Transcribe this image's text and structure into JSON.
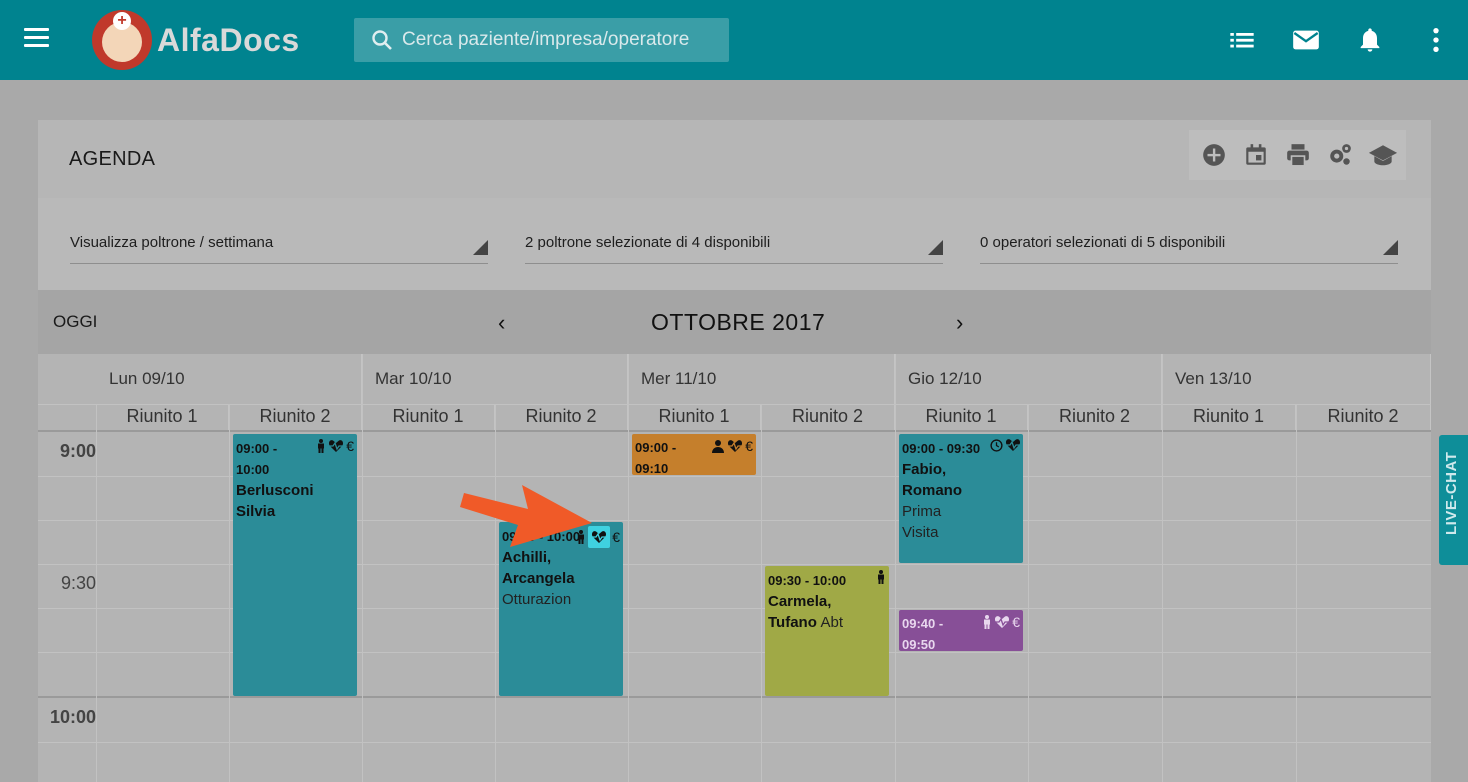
{
  "app": {
    "logo_text": "AlfaDocs"
  },
  "search": {
    "placeholder": "Cerca paziente/impresa/operatore"
  },
  "agenda": {
    "title": "AGENDA",
    "filters": {
      "view": "Visualizza poltrone / settimana",
      "chairs": "2 poltrone selezionate di 4 disponibili",
      "operators": "0 operatori selezionati di 5 disponibili"
    },
    "today_label": "OGGI",
    "month_label": "OTTOBRE 2017",
    "days": [
      "Lun 09/10",
      "Mar 10/10",
      "Mer 11/10",
      "Gio 12/10",
      "Ven 13/10"
    ],
    "chairs": [
      "Riunito 1",
      "Riunito 2"
    ],
    "times": [
      "9:00",
      "9:30",
      "10:00"
    ]
  },
  "appointments": [
    {
      "time": "09:00 - 10:00",
      "name": "Berlusconi Silvia",
      "detail": ""
    },
    {
      "time": "09:00 - 10:00",
      "time_visible": "10:00",
      "name": "Achilli, Arcangela",
      "detail": "Otturazion"
    },
    {
      "time": "09:00 - 09:10",
      "name": "",
      "detail": ""
    },
    {
      "time": "09:30 - 10:00",
      "name": "Carmela, Tufano",
      "detail": "Abt"
    },
    {
      "time": "09:00 - 09:30",
      "name": "Fabio, Romano",
      "detail": "Prima Visita"
    },
    {
      "time": "09:40 - 09:50",
      "name": "",
      "detail": ""
    }
  ],
  "live_chat": "LIVE-CHAT",
  "colors": {
    "topbar": "#00838f",
    "teal": "#2b8c98",
    "orange": "#c57f2c",
    "olive": "#a0a946",
    "purple": "#874f97",
    "arrow": "#f05a28"
  }
}
